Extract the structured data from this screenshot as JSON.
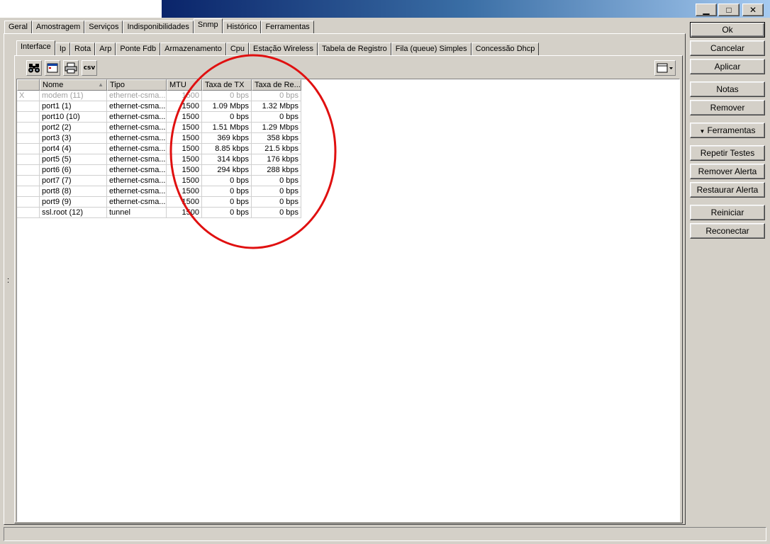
{
  "window": {
    "minimize_glyph": "▁",
    "maximize_glyph": "□",
    "close_glyph": "✕"
  },
  "main_tabs": [
    "Geral",
    "Amostragem",
    "Serviços",
    "Indisponibilidades",
    "Snmp",
    "Histórico",
    "Ferramentas"
  ],
  "main_tab_active": "Snmp",
  "sub_tabs": [
    "Interface",
    "Ip",
    "Rota",
    "Arp",
    "Ponte Fdb",
    "Armazenamento",
    "Cpu",
    "Estação Wireless",
    "Tabela de Registro",
    "Fila (queue) Simples",
    "Concessão Dhcp"
  ],
  "sub_tab_active": "Interface",
  "toolbar": {
    "icons": [
      "binoculars-icon",
      "window-icon",
      "printer-icon",
      "csv-icon"
    ],
    "csv_label": "csv"
  },
  "table": {
    "columns": [
      "",
      "Nome",
      "Tipo",
      "MTU",
      "Taxa de TX",
      "Taxa de Re..."
    ],
    "sort_indicator": "▲",
    "rows": [
      {
        "flag": "X",
        "name": "modem (11)",
        "type": "ethernet-csma...",
        "mtu": "1500",
        "tx": "0 bps",
        "rx": "0 bps",
        "disabled": true
      },
      {
        "flag": "",
        "name": "port1 (1)",
        "type": "ethernet-csma...",
        "mtu": "1500",
        "tx": "1.09 Mbps",
        "rx": "1.32 Mbps",
        "disabled": false
      },
      {
        "flag": "",
        "name": "port10 (10)",
        "type": "ethernet-csma...",
        "mtu": "1500",
        "tx": "0 bps",
        "rx": "0 bps",
        "disabled": false
      },
      {
        "flag": "",
        "name": "port2 (2)",
        "type": "ethernet-csma...",
        "mtu": "1500",
        "tx": "1.51 Mbps",
        "rx": "1.29 Mbps",
        "disabled": false
      },
      {
        "flag": "",
        "name": "port3 (3)",
        "type": "ethernet-csma...",
        "mtu": "1500",
        "tx": "369 kbps",
        "rx": "358 kbps",
        "disabled": false
      },
      {
        "flag": "",
        "name": "port4 (4)",
        "type": "ethernet-csma...",
        "mtu": "1500",
        "tx": "8.85 kbps",
        "rx": "21.5 kbps",
        "disabled": false
      },
      {
        "flag": "",
        "name": "port5 (5)",
        "type": "ethernet-csma...",
        "mtu": "1500",
        "tx": "314 kbps",
        "rx": "176 kbps",
        "disabled": false
      },
      {
        "flag": "",
        "name": "port6 (6)",
        "type": "ethernet-csma...",
        "mtu": "1500",
        "tx": "294 kbps",
        "rx": "288 kbps",
        "disabled": false
      },
      {
        "flag": "",
        "name": "port7 (7)",
        "type": "ethernet-csma...",
        "mtu": "1500",
        "tx": "0 bps",
        "rx": "0 bps",
        "disabled": false
      },
      {
        "flag": "",
        "name": "port8 (8)",
        "type": "ethernet-csma...",
        "mtu": "1500",
        "tx": "0 bps",
        "rx": "0 bps",
        "disabled": false
      },
      {
        "flag": "",
        "name": "port9 (9)",
        "type": "ethernet-csma...",
        "mtu": "1500",
        "tx": "0 bps",
        "rx": "0 bps",
        "disabled": false
      },
      {
        "flag": "",
        "name": "ssl.root (12)",
        "type": "tunnel",
        "mtu": "1500",
        "tx": "0 bps",
        "rx": "0 bps",
        "disabled": false
      }
    ]
  },
  "side_buttons": [
    "Ok",
    "Cancelar",
    "Aplicar",
    "Notas",
    "Remover",
    "Ferramentas",
    "Repetir Testes",
    "Remover Alerta",
    "Restaurar Alerta",
    "Reiniciar",
    "Reconectar"
  ],
  "ferramentas_arrow": "▼",
  "splitter_glyph": ":",
  "annotation_color": "#e01010"
}
